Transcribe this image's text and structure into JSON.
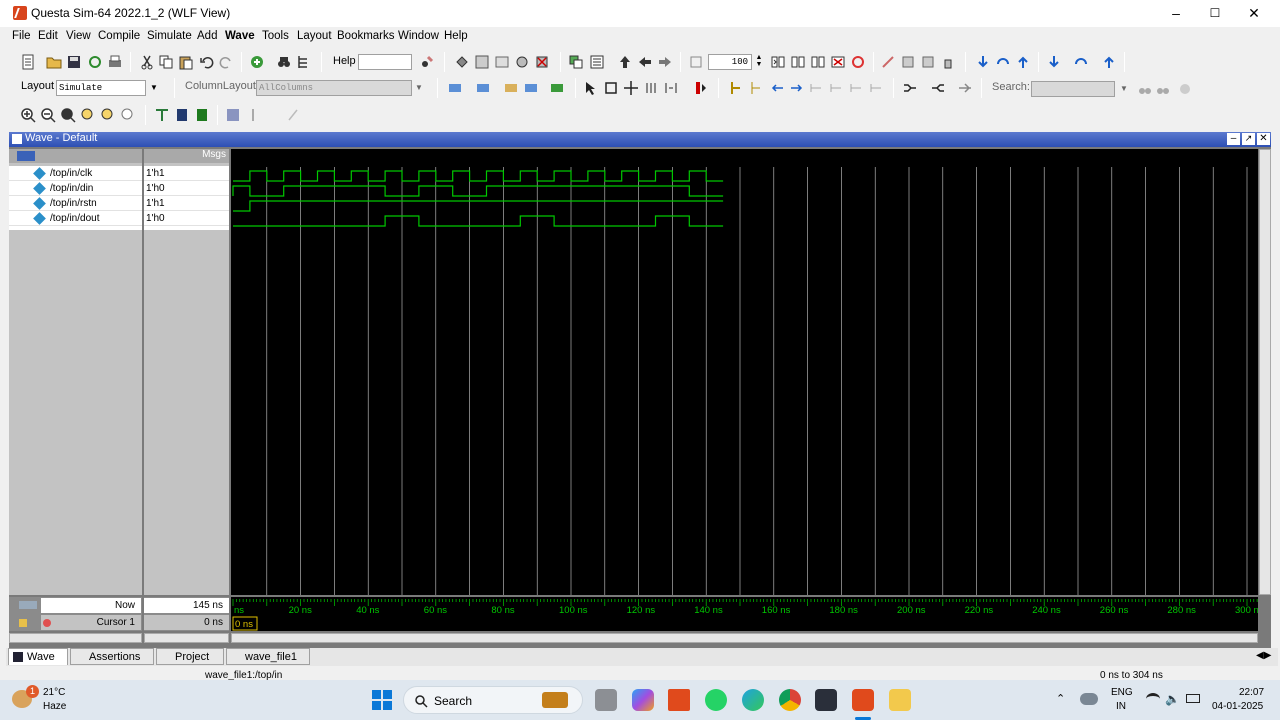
{
  "window": {
    "title": "Questa Sim-64 2022.1_2 (WLF View)"
  },
  "menubar": [
    "File",
    "Edit",
    "View",
    "Compile",
    "Simulate",
    "Add",
    "Wave",
    "Tools",
    "Layout",
    "Bookmarks",
    "Window",
    "Help"
  ],
  "toolbar": {
    "help_label": "Help",
    "zoom_value": "100",
    "layout_label": "Layout",
    "layout_value": "Simulate",
    "column_layout_label": "ColumnLayout",
    "column_layout_value": "AllColumns",
    "search_label": "Search:"
  },
  "wave": {
    "panel_title": "Wave - Default",
    "msgs_header": "Msgs",
    "signals": [
      {
        "name": "/top/in/clk",
        "value": "1'h1"
      },
      {
        "name": "/top/in/din",
        "value": "1'h0"
      },
      {
        "name": "/top/in/rstn",
        "value": "1'h1"
      },
      {
        "name": "/top/in/dout",
        "value": "1'h0"
      }
    ],
    "now_label": "Now",
    "now_value": "145 ns",
    "cursor_label": "Cursor 1",
    "cursor_value": "0 ns",
    "cursor_marker": "0 ns",
    "time_ticks": [
      "ns",
      "20 ns",
      "40 ns",
      "60 ns",
      "80 ns",
      "100 ns",
      "120 ns",
      "140 ns",
      "160 ns",
      "180 ns",
      "200 ns",
      "220 ns",
      "240 ns",
      "260 ns",
      "280 ns",
      "300 ns"
    ],
    "waveform_color": "#00c800",
    "grid_color": "#cfcfcf",
    "sim_end_ns": 145,
    "view_range_ns": [
      0,
      304
    ],
    "clk_period_ns": 10,
    "din_transitions_ns": [
      0,
      5,
      15,
      45,
      55,
      65,
      75,
      135
    ],
    "din_initial": 0,
    "dout_transitions_ns": [
      45,
      55,
      85,
      95,
      125,
      135
    ],
    "dout_initial": 0,
    "rstn_rise_ns": 5
  },
  "tabs": [
    "Wave",
    "Assertions",
    "Project",
    "wave_file1"
  ],
  "status": {
    "path": "wave_file1:/top/in",
    "range": "0 ns to 304 ns"
  },
  "taskbar": {
    "weather_temp": "21°C",
    "weather_desc": "Haze",
    "notif_count": "1",
    "search_label": "Search",
    "lang": "ENG",
    "region": "IN",
    "time": "22:07",
    "date": "04-01-2025"
  }
}
